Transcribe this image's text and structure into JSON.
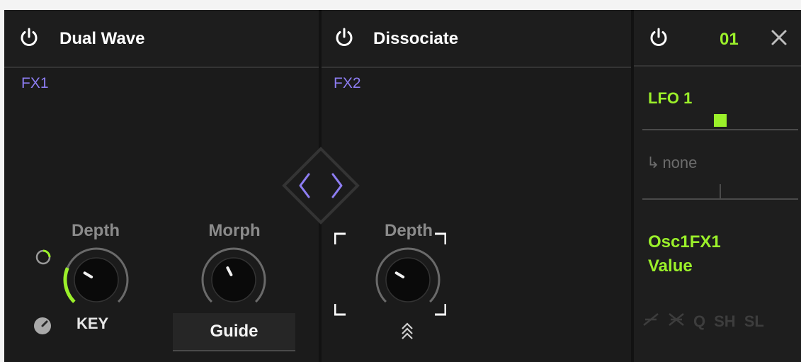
{
  "fx1": {
    "title": "Dual Wave",
    "slot_label": "FX1",
    "knobs": [
      {
        "label": "Depth",
        "value": 0.28,
        "mod_amount": 0.25,
        "mod_color": "#9bf02a"
      },
      {
        "label": "Morph",
        "value": 0.4
      }
    ],
    "key_label": "KEY",
    "guide_label": "Guide"
  },
  "fx2": {
    "title": "Dissociate",
    "slot_label": "FX2",
    "knobs": [
      {
        "label": "Depth",
        "value": 0.28
      }
    ]
  },
  "nav": {
    "icon": "chevron-left-right-icon",
    "color": "#8d7df2"
  },
  "mod": {
    "slot_number": "01",
    "source": "LFO 1",
    "amount": 0.5,
    "via": "none",
    "target_line1": "Osc1FX1",
    "target_line2": "Value",
    "curve_options": [
      "Q",
      "SH",
      "SL"
    ],
    "accent": "#9bf02a"
  }
}
